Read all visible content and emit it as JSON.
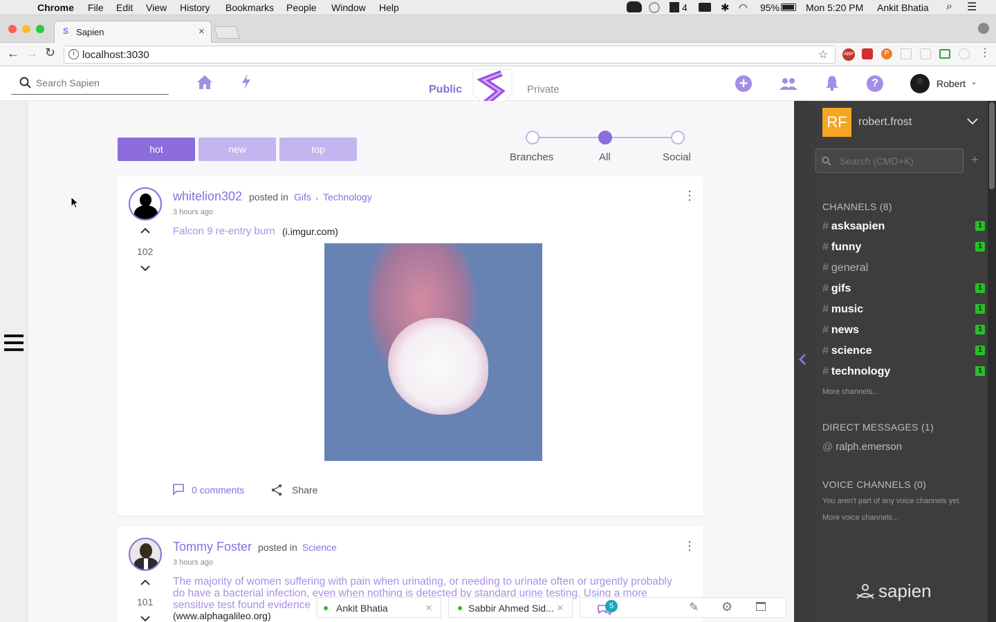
{
  "macbar": {
    "app": "Chrome",
    "menu": [
      "File",
      "Edit",
      "View",
      "History",
      "Bookmarks",
      "People",
      "Window",
      "Help"
    ],
    "status": {
      "notif_count": "4",
      "battery": "95%",
      "clock": "Mon 5:20 PM",
      "user": "Ankit Bhatia"
    }
  },
  "browser": {
    "tab_title": "Sapien",
    "url": "localhost:3030"
  },
  "header": {
    "search_placeholder": "Search Sapien",
    "public_label": "Public",
    "private_label": "Private",
    "user_name": "Robert"
  },
  "sort_buttons": [
    {
      "label": "hot",
      "active": true
    },
    {
      "label": "new",
      "active": false
    },
    {
      "label": "top",
      "active": false
    }
  ],
  "feed_slider": {
    "stops": [
      "Branches",
      "All",
      "Social"
    ],
    "selected": "All"
  },
  "posts": [
    {
      "author": "whitelion302",
      "posted_in_label": "posted in",
      "channels": [
        "Gifs",
        "Technology"
      ],
      "separator": ",",
      "time": "3 hours ago",
      "votes": "102",
      "title": "Falcon 9 re-entry burn",
      "domain": "(i.imgur.com)",
      "comments_label": "0 comments",
      "share_label": "Share"
    },
    {
      "author": "Tommy Foster",
      "posted_in_label": "posted in",
      "channels": [
        "Science"
      ],
      "time": "3 hours ago",
      "votes": "101",
      "title_line1": "The majority of women suffering with pain when urinating, or needing to urinate often or urgently probably",
      "title_line2": "do have a bacterial infection, even when nothing is detected by standard urine testing. Using a more",
      "title_line3": "sensitive test found evidence",
      "domain": "(www.alphagalileo.org)"
    }
  ],
  "sidebar": {
    "initials": "RF",
    "username": "robert.frost",
    "search_placeholder": "Search (CMD+K)",
    "channels_header": "CHANNELS (8)",
    "channels": [
      {
        "name": "asksapien",
        "unread": "1"
      },
      {
        "name": "funny",
        "unread": "1"
      },
      {
        "name": "general",
        "unread": ""
      },
      {
        "name": "gifs",
        "unread": "1"
      },
      {
        "name": "music",
        "unread": "1"
      },
      {
        "name": "news",
        "unread": "1"
      },
      {
        "name": "science",
        "unread": "1"
      },
      {
        "name": "technology",
        "unread": "1"
      }
    ],
    "more_channels": "More channels...",
    "dm_header": "DIRECT MESSAGES (1)",
    "dm_user": "ralph.emerson",
    "voice_header": "VOICE CHANNELS (0)",
    "voice_note": "You aren't part of any voice channels yet.",
    "more_voice": "More voice channels...",
    "brand": "sapien"
  },
  "chat": {
    "tab1": "Ankit Bhatia",
    "tab2": "Sabbir Ahmed Sid...",
    "unread_count": "5"
  }
}
